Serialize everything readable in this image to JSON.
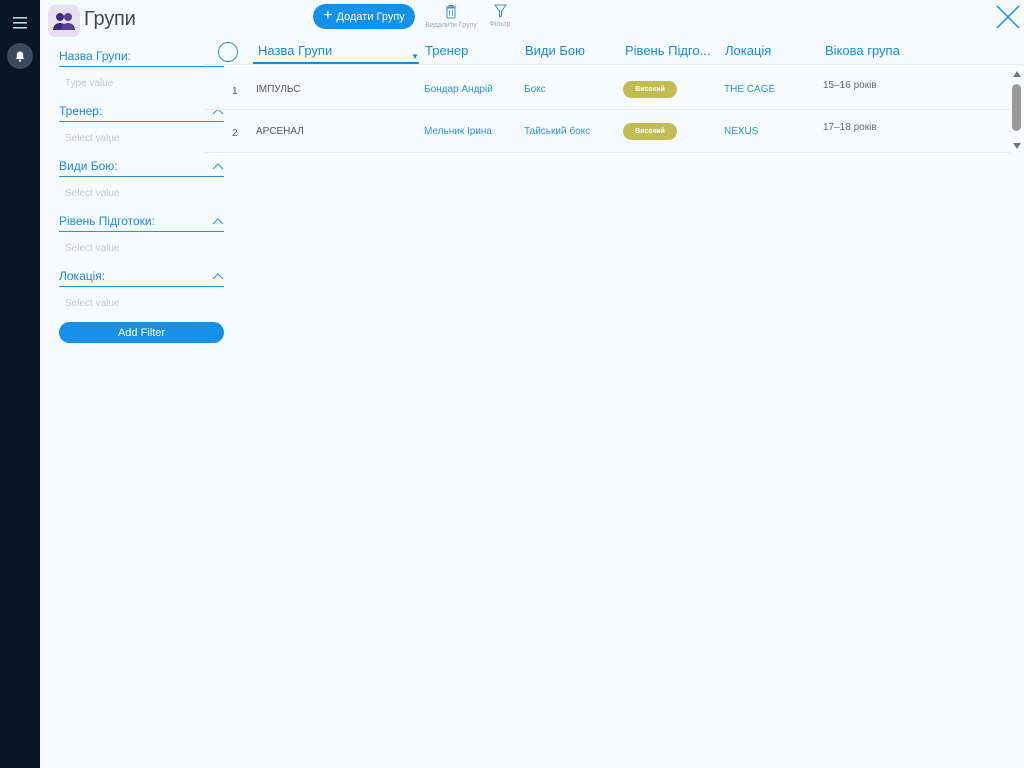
{
  "colors": {
    "accent": "#1591ea",
    "link": "#2d94de",
    "rail": "#081424",
    "badge": "#c2bd52"
  },
  "rail": {
    "menu_icon": "hamburger-menu-icon",
    "bell_icon": "bell-icon"
  },
  "header": {
    "app_icon": "group-users-icon",
    "title": "Групи",
    "add_button": "Додати Групу",
    "delete_label": "Видалити Групу",
    "filter_label": "Фільтр",
    "close_icon": "close-icon"
  },
  "filters": {
    "items": [
      {
        "label": "Назва Групи:",
        "placeholder": "Type value"
      },
      {
        "label": "Тренер:",
        "placeholder": "Select value"
      },
      {
        "label": "Види Бою:",
        "placeholder": "Select value"
      },
      {
        "label": "Рівень Підготоки:",
        "placeholder": "Select value"
      },
      {
        "label": "Локація:",
        "placeholder": "Select value"
      }
    ],
    "add_button": "Add Filter"
  },
  "table": {
    "columns": [
      "Назва Групи",
      "Тренер",
      "Види Бою",
      "Рівень Підго...",
      "Локація",
      "Вікова група"
    ],
    "sorted_column": "Назва Групи",
    "rows": [
      {
        "num": "1",
        "name": "ІМПУЛЬС",
        "trainer": "Бондар Андрій",
        "fight": "Бокс",
        "level": "Високий",
        "location": "THE CAGE",
        "age": "15–16 років"
      },
      {
        "num": "2",
        "name": "АРСЕНАЛ",
        "trainer": "Мельник Ірина",
        "fight": "Тайський бокс",
        "level": "Високий",
        "location": "NEXUS",
        "age": "17–18 років"
      }
    ]
  }
}
